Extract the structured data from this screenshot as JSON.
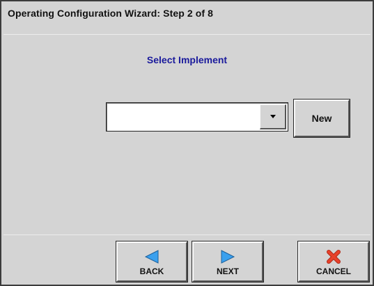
{
  "window": {
    "title": "Operating Configuration Wizard:  Step 2 of 8"
  },
  "main": {
    "heading": "Select Implement",
    "implement_select": {
      "value": ""
    },
    "new_label": "New"
  },
  "footer": {
    "back_label": "BACK",
    "next_label": "NEXT",
    "cancel_label": "CANCEL"
  },
  "icons": {
    "back": "left-triangle-arrow-icon",
    "next": "right-triangle-arrow-icon",
    "cancel": "red-x-icon",
    "dropdown": "chevron-down-icon"
  },
  "colors": {
    "arrow_icon": "#3aa0ee",
    "cancel_icon": "#e8412a",
    "heading_text": "#1a1a9c",
    "background": "#d4d4d4"
  }
}
